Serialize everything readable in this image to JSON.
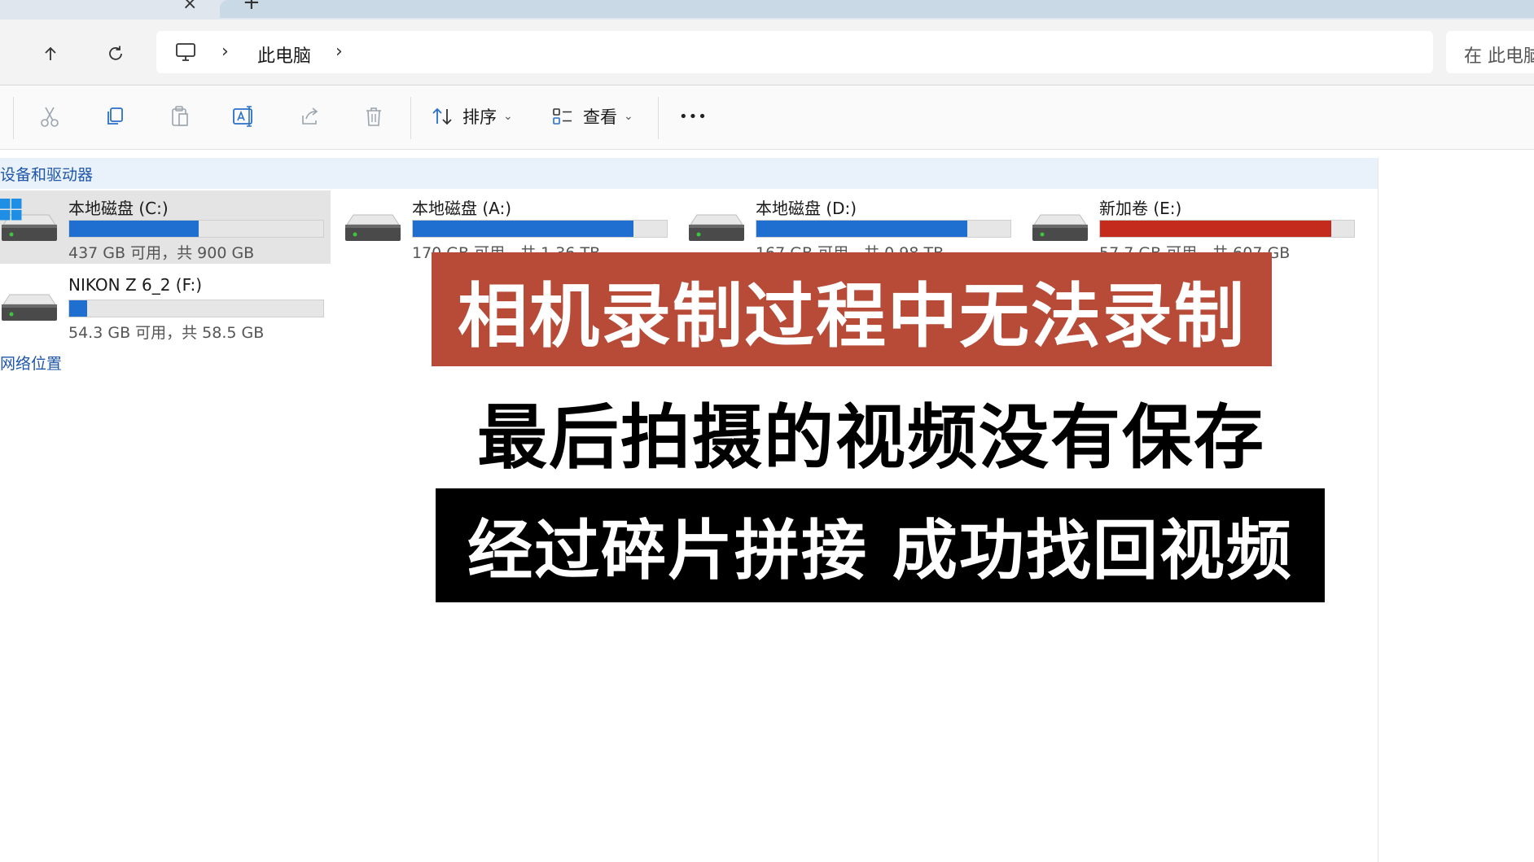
{
  "tabs": {
    "close_glyph": "×",
    "add_glyph": "+"
  },
  "nav": {
    "up_icon": "arrow-up-icon",
    "refresh_icon": "refresh-icon"
  },
  "address": {
    "icon": "computer-icon",
    "separator": "›",
    "location": "此电脑"
  },
  "search": {
    "placeholder": "在 此电脑"
  },
  "commands": {
    "cut_icon": "scissors-icon",
    "copy_icon": "copy-icon",
    "paste_icon": "paste-icon",
    "rename_icon": "rename-icon",
    "share_icon": "share-icon",
    "delete_icon": "trash-icon",
    "sort_label": "排序",
    "view_label": "查看",
    "more_label": "•••"
  },
  "groups": {
    "devices": "设备和驱动器",
    "network": "网络位置"
  },
  "drives": [
    {
      "name": "本地磁盘 (C:)",
      "free_text": "437 GB 可用，共 900 GB",
      "used_fraction": 0.51,
      "bar_color": "#1f6fd0",
      "selected": true,
      "windows_logo": true
    },
    {
      "name": "本地磁盘 (A:)",
      "free_text": "170 GB 可用，共 1.36 TB",
      "used_fraction": 0.87,
      "bar_color": "#1f6fd0",
      "selected": false
    },
    {
      "name": "本地磁盘 (D:)",
      "free_text": "167 GB 可用，共 0.98 TB",
      "used_fraction": 0.83,
      "bar_color": "#1f6fd0",
      "selected": false
    },
    {
      "name": "新加卷 (E:)",
      "free_text": "57.7 GB 可用，共 607 GB",
      "used_fraction": 0.91,
      "bar_color": "#c42b1c",
      "selected": false
    },
    {
      "name": "NIKON Z 6_2 (F:)",
      "free_text": "54.3 GB 可用，共 58.5 GB",
      "used_fraction": 0.07,
      "bar_color": "#1f6fd0",
      "selected": false
    }
  ],
  "overlay": {
    "line1": "相机录制过程中无法录制",
    "line2": "最后拍摄的视频没有保存",
    "line3": "经过碎片拼接 成功找回视频",
    "line1_bg": "#b74b38",
    "line3_bg": "#000000"
  }
}
